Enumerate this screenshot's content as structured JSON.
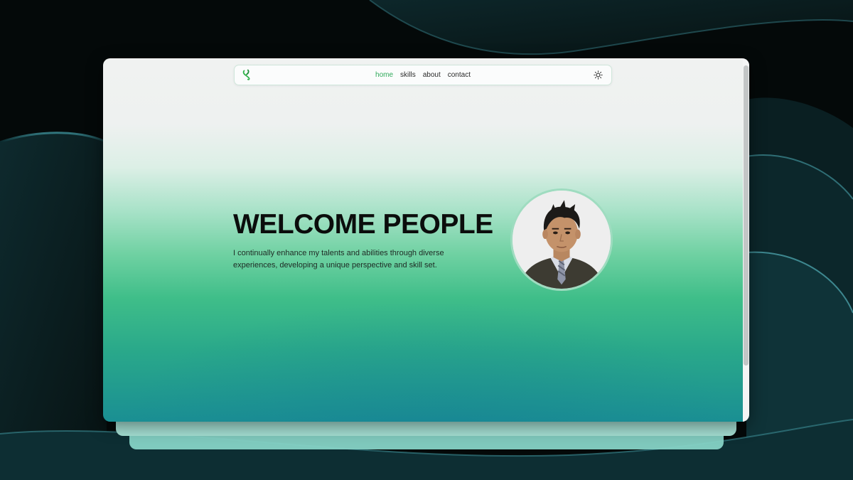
{
  "nav": {
    "logo_icon": "paperclip-icon",
    "links": [
      {
        "label": "home",
        "active": true
      },
      {
        "label": "skills",
        "active": false
      },
      {
        "label": "about",
        "active": false
      },
      {
        "label": "contact",
        "active": false
      }
    ],
    "theme_toggle_icon": "sun-icon"
  },
  "hero": {
    "title": "WELCOME PEOPLE",
    "description": "I continually enhance my talents and abilities through diverse experiences, developing a unique perspective and skill set.",
    "avatar_icon": "profile-photo"
  },
  "colors": {
    "accent": "#2fa95a",
    "gradient_top": "#f0f2f1",
    "gradient_mid": "#3fbe89",
    "gradient_bottom": "#1a8f93",
    "backdrop": "#050b0b"
  }
}
